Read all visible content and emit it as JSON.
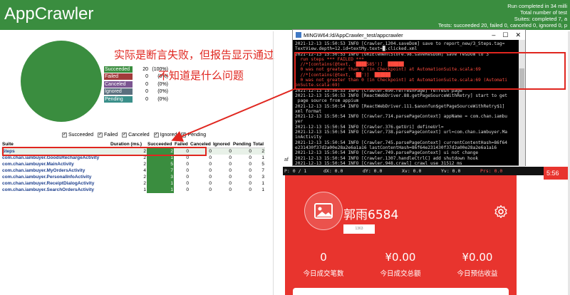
{
  "header": {
    "title": "AppCrawler",
    "summary": [
      "Run completed in 34 milli",
      "Total number of test",
      "Suites: completed 7, a",
      "Tests: succeeded 20, failed 0, canceled 0, ignored 0, p"
    ]
  },
  "legend": [
    {
      "label": "Succeeded",
      "count": "20",
      "pct": "(100%)",
      "color": "#3a8d3f"
    },
    {
      "label": "Failed",
      "count": "0",
      "pct": "(0%)",
      "color": "#a23b3b"
    },
    {
      "label": "Canceled",
      "count": "0",
      "pct": "(0%)",
      "color": "#7b5591"
    },
    {
      "label": "Ignored",
      "count": "0",
      "pct": "(0%)",
      "color": "#5b6f7e"
    },
    {
      "label": "Pending",
      "count": "0",
      "pct": "(0%)",
      "color": "#3a8f8a"
    }
  ],
  "notes": {
    "line1": "实际是断言失败，但报告显示通过",
    "line2": "不知道是什么问题"
  },
  "filters": [
    "Succeeded",
    "Failed",
    "Canceled",
    "Ignored",
    "Pending"
  ],
  "table": {
    "headers": [
      "Suite",
      "Duration (ms.)",
      "Succeeded",
      "Failed",
      "Canceled",
      "Ignored",
      "Pending",
      "Total"
    ],
    "rows": [
      [
        "Steps",
        "2",
        "2",
        "0",
        "0",
        "0",
        "0",
        "2"
      ],
      [
        "com.chan.iambuyer.GoodsRechargeActivity",
        "2",
        "1",
        "0",
        "0",
        "0",
        "0",
        "1"
      ],
      [
        "com.chan.iambuyer.MainActivity",
        "2",
        "5",
        "0",
        "0",
        "0",
        "0",
        "5"
      ],
      [
        "com.chan.iambuyer.MyOrdersActivity",
        "4",
        "7",
        "0",
        "0",
        "0",
        "0",
        "7"
      ],
      [
        "com.chan.iambuyer.PersonalInfoActivity",
        "2",
        "3",
        "0",
        "0",
        "0",
        "0",
        "3"
      ],
      [
        "com.chan.iambuyer.ReceiptDialogActivity",
        "2",
        "1",
        "0",
        "0",
        "0",
        "0",
        "1"
      ],
      [
        "com.chan.iambuyer.SearchOrdersActivity",
        "1",
        "1",
        "0",
        "0",
        "0",
        "0",
        "1"
      ]
    ]
  },
  "terminal": {
    "title": "MINGW64:/d/AppCrawler_test/appcrawler",
    "controls": [
      "–",
      "☐",
      "✕"
    ],
    "lines": [
      {
        "t": "2021-12-13 15:50:53 INFO [Crawler.1204.saveDom] save to report_new/3_Steps.tag=",
        "err": false
      },
      {
        "t": "TextView.depth=12.id=textMy.text=█.clicked.xml",
        "err": false
      },
      {
        "t": "2021-12-13 15:50:53 INFO [URIElementStore.98.saveResDom] save resDom to 3",
        "err": false
      },
      {
        "t": "  run steps *** FAILED ***",
        "err": true
      },
      {
        "t": "  //*[contains(@text, '████585')]  ██████",
        "err": true
      },
      {
        "t": "  0 was not greater than 0 (in Checkpoint) at AutomationSuite.scala:69",
        "err": true
      },
      {
        "t": "  //*[contains(@text, '██')]  ██████",
        "err": true
      },
      {
        "t": "  0 was not greater than 0 (in Checkpoint) at AutomationSuite.scala:69 (Automati",
        "err": true
      },
      {
        "t": "onSuite.scala:69)",
        "err": true
      },
      {
        "t": "2021-12-13 15:50:53 INFO [Crawler.690.refreshPage] refresh page",
        "err": false
      },
      {
        "t": "2021-12-13 15:50:53 INFO [ReactWebDriver.88.getPageSourceWithRetry] start to get",
        "err": false
      },
      {
        "t": " page source from appium",
        "err": false
      },
      {
        "t": "2021-12-13 15:50:54 INFO [ReactWebDriver.111.$anonfun$getPageSourceWithRetry$1]",
        "err": false
      },
      {
        "t": "xml format",
        "err": false
      },
      {
        "t": "2021-12-13 15:50:54 INFO [Crawler.714.parsePageContext] appName = com.chan.iambu",
        "err": false
      },
      {
        "t": "yer",
        "err": false
      },
      {
        "t": "2021-12-13 15:50:54 INFO [Crawler.376.getUri] defineUrl=",
        "err": false
      },
      {
        "t": "2021-12-13 15:50:54 INFO [Crawler.738.parsePageContext] url=com.chan.iambuyer.Ma",
        "err": false
      },
      {
        "t": "inActivity",
        "err": false
      },
      {
        "t": "2021-12-13 15:50:54 INFO [Crawler.745.parsePageContext] currentContentHash=86f64",
        "err": false
      },
      {
        "t": "e231430f37d2a00e28a2e6a1a16 lastContentHash=86f64e231430f37d2a00e28a2e6a1a16",
        "err": false
      },
      {
        "t": "2021-12-13 15:50:54 INFO [Crawler.749.parsePageContext] ui not change",
        "err": false
      },
      {
        "t": "2021-12-13 15:50:54 INFO [Crawler.1307.handleCtrlC] add shutdown hook",
        "err": false
      },
      {
        "t": "2021-12-13 15:50:54 INFO [Crawler.948.crawl] crawl use 31512 ms",
        "err": false
      }
    ]
  },
  "af_label": "af",
  "pointer_bar": [
    "P: 0 / 1",
    "dX: 0.0",
    "dY: 0.0",
    "Xv: 0.0",
    "Yv: 0.0",
    "Prs: 0.0"
  ],
  "phone": {
    "username": "郭雨6584",
    "user_tag": "1363",
    "corner": "5:56",
    "stats": [
      {
        "value": "0",
        "label": "今日成交笔数"
      },
      {
        "value": "¥0.00",
        "label": "今日成交总额"
      },
      {
        "value": "¥0.00",
        "label": "今日预估收益"
      }
    ]
  }
}
